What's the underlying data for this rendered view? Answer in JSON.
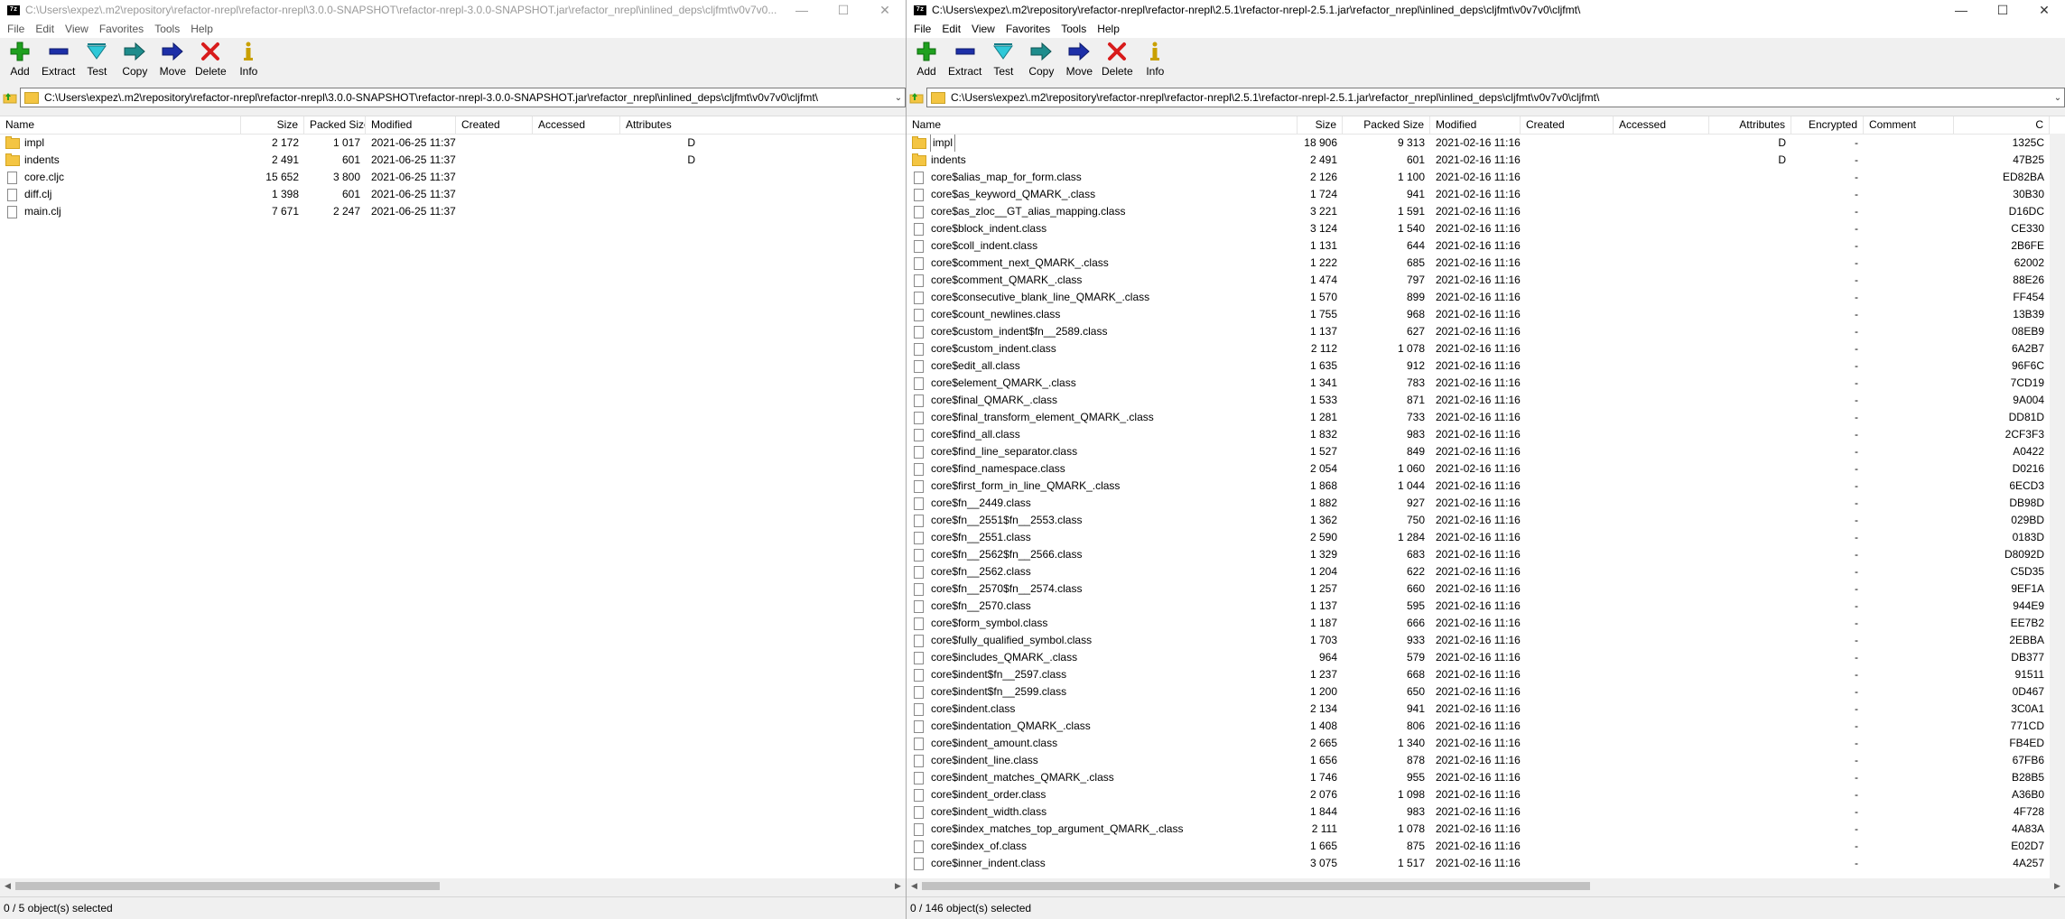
{
  "left": {
    "title": "C:\\Users\\expez\\.m2\\repository\\refactor-nrepl\\refactor-nrepl\\3.0.0-SNAPSHOT\\refactor-nrepl-3.0.0-SNAPSHOT.jar\\refactor_nrepl\\inlined_deps\\cljfmt\\v0v7v0...",
    "menu": [
      "File",
      "Edit",
      "View",
      "Favorites",
      "Tools",
      "Help"
    ],
    "toolbar": [
      "Add",
      "Extract",
      "Test",
      "Copy",
      "Move",
      "Delete",
      "Info"
    ],
    "address": "C:\\Users\\expez\\.m2\\repository\\refactor-nrepl\\refactor-nrepl\\3.0.0-SNAPSHOT\\refactor-nrepl-3.0.0-SNAPSHOT.jar\\refactor_nrepl\\inlined_deps\\cljfmt\\v0v7v0\\cljfmt\\",
    "columns": [
      "Name",
      "Size",
      "Packed Size",
      "Modified",
      "Created",
      "Accessed",
      "Attributes"
    ],
    "rows": [
      {
        "type": "folder",
        "name": "impl",
        "size": "2 172",
        "packed": "1 017",
        "modified": "2021-06-25 11:37",
        "attr": "D"
      },
      {
        "type": "folder",
        "name": "indents",
        "size": "2 491",
        "packed": "601",
        "modified": "2021-06-25 11:37",
        "attr": "D"
      },
      {
        "type": "file",
        "name": "core.cljc",
        "size": "15 652",
        "packed": "3 800",
        "modified": "2021-06-25 11:37",
        "attr": ""
      },
      {
        "type": "file",
        "name": "diff.clj",
        "size": "1 398",
        "packed": "601",
        "modified": "2021-06-25 11:37",
        "attr": ""
      },
      {
        "type": "file",
        "name": "main.clj",
        "size": "7 671",
        "packed": "2 247",
        "modified": "2021-06-25 11:37",
        "attr": ""
      }
    ],
    "status": "0 / 5 object(s) selected"
  },
  "right": {
    "title": "C:\\Users\\expez\\.m2\\repository\\refactor-nrepl\\refactor-nrepl\\2.5.1\\refactor-nrepl-2.5.1.jar\\refactor_nrepl\\inlined_deps\\cljfmt\\v0v7v0\\cljfmt\\",
    "menu": [
      "File",
      "Edit",
      "View",
      "Favorites",
      "Tools",
      "Help"
    ],
    "toolbar": [
      "Add",
      "Extract",
      "Test",
      "Copy",
      "Move",
      "Delete",
      "Info"
    ],
    "address": "C:\\Users\\expez\\.m2\\repository\\refactor-nrepl\\refactor-nrepl\\2.5.1\\refactor-nrepl-2.5.1.jar\\refactor_nrepl\\inlined_deps\\cljfmt\\v0v7v0\\cljfmt\\",
    "columns": [
      "Name",
      "Size",
      "Packed Size",
      "Modified",
      "Created",
      "Accessed",
      "Attributes",
      "Encrypted",
      "Comment",
      "C"
    ],
    "rows": [
      {
        "type": "folder",
        "name": "impl",
        "size": "18 906",
        "packed": "9 313",
        "modified": "2021-02-16 11:16",
        "attr": "D",
        "enc": "-",
        "crc": "1325C"
      },
      {
        "type": "folder",
        "name": "indents",
        "size": "2 491",
        "packed": "601",
        "modified": "2021-02-16 11:16",
        "attr": "D",
        "enc": "-",
        "crc": "47B25"
      },
      {
        "type": "file",
        "name": "core$alias_map_for_form.class",
        "size": "2 126",
        "packed": "1 100",
        "modified": "2021-02-16 11:16",
        "attr": "",
        "enc": "-",
        "crc": "ED82BA"
      },
      {
        "type": "file",
        "name": "core$as_keyword_QMARK_.class",
        "size": "1 724",
        "packed": "941",
        "modified": "2021-02-16 11:16",
        "attr": "",
        "enc": "-",
        "crc": "30B30"
      },
      {
        "type": "file",
        "name": "core$as_zloc__GT_alias_mapping.class",
        "size": "3 221",
        "packed": "1 591",
        "modified": "2021-02-16 11:16",
        "attr": "",
        "enc": "-",
        "crc": "D16DC"
      },
      {
        "type": "file",
        "name": "core$block_indent.class",
        "size": "3 124",
        "packed": "1 540",
        "modified": "2021-02-16 11:16",
        "attr": "",
        "enc": "-",
        "crc": "CE330"
      },
      {
        "type": "file",
        "name": "core$coll_indent.class",
        "size": "1 131",
        "packed": "644",
        "modified": "2021-02-16 11:16",
        "attr": "",
        "enc": "-",
        "crc": "2B6FE"
      },
      {
        "type": "file",
        "name": "core$comment_next_QMARK_.class",
        "size": "1 222",
        "packed": "685",
        "modified": "2021-02-16 11:16",
        "attr": "",
        "enc": "-",
        "crc": "62002"
      },
      {
        "type": "file",
        "name": "core$comment_QMARK_.class",
        "size": "1 474",
        "packed": "797",
        "modified": "2021-02-16 11:16",
        "attr": "",
        "enc": "-",
        "crc": "88E26"
      },
      {
        "type": "file",
        "name": "core$consecutive_blank_line_QMARK_.class",
        "size": "1 570",
        "packed": "899",
        "modified": "2021-02-16 11:16",
        "attr": "",
        "enc": "-",
        "crc": "FF454"
      },
      {
        "type": "file",
        "name": "core$count_newlines.class",
        "size": "1 755",
        "packed": "968",
        "modified": "2021-02-16 11:16",
        "attr": "",
        "enc": "-",
        "crc": "13B39"
      },
      {
        "type": "file",
        "name": "core$custom_indent$fn__2589.class",
        "size": "1 137",
        "packed": "627",
        "modified": "2021-02-16 11:16",
        "attr": "",
        "enc": "-",
        "crc": "08EB9"
      },
      {
        "type": "file",
        "name": "core$custom_indent.class",
        "size": "2 112",
        "packed": "1 078",
        "modified": "2021-02-16 11:16",
        "attr": "",
        "enc": "-",
        "crc": "6A2B7"
      },
      {
        "type": "file",
        "name": "core$edit_all.class",
        "size": "1 635",
        "packed": "912",
        "modified": "2021-02-16 11:16",
        "attr": "",
        "enc": "-",
        "crc": "96F6C"
      },
      {
        "type": "file",
        "name": "core$element_QMARK_.class",
        "size": "1 341",
        "packed": "783",
        "modified": "2021-02-16 11:16",
        "attr": "",
        "enc": "-",
        "crc": "7CD19"
      },
      {
        "type": "file",
        "name": "core$final_QMARK_.class",
        "size": "1 533",
        "packed": "871",
        "modified": "2021-02-16 11:16",
        "attr": "",
        "enc": "-",
        "crc": "9A004"
      },
      {
        "type": "file",
        "name": "core$final_transform_element_QMARK_.class",
        "size": "1 281",
        "packed": "733",
        "modified": "2021-02-16 11:16",
        "attr": "",
        "enc": "-",
        "crc": "DD81D"
      },
      {
        "type": "file",
        "name": "core$find_all.class",
        "size": "1 832",
        "packed": "983",
        "modified": "2021-02-16 11:16",
        "attr": "",
        "enc": "-",
        "crc": "2CF3F3"
      },
      {
        "type": "file",
        "name": "core$find_line_separator.class",
        "size": "1 527",
        "packed": "849",
        "modified": "2021-02-16 11:16",
        "attr": "",
        "enc": "-",
        "crc": "A0422"
      },
      {
        "type": "file",
        "name": "core$find_namespace.class",
        "size": "2 054",
        "packed": "1 060",
        "modified": "2021-02-16 11:16",
        "attr": "",
        "enc": "-",
        "crc": "D0216"
      },
      {
        "type": "file",
        "name": "core$first_form_in_line_QMARK_.class",
        "size": "1 868",
        "packed": "1 044",
        "modified": "2021-02-16 11:16",
        "attr": "",
        "enc": "-",
        "crc": "6ECD3"
      },
      {
        "type": "file",
        "name": "core$fn__2449.class",
        "size": "1 882",
        "packed": "927",
        "modified": "2021-02-16 11:16",
        "attr": "",
        "enc": "-",
        "crc": "DB98D"
      },
      {
        "type": "file",
        "name": "core$fn__2551$fn__2553.class",
        "size": "1 362",
        "packed": "750",
        "modified": "2021-02-16 11:16",
        "attr": "",
        "enc": "-",
        "crc": "029BD"
      },
      {
        "type": "file",
        "name": "core$fn__2551.class",
        "size": "2 590",
        "packed": "1 284",
        "modified": "2021-02-16 11:16",
        "attr": "",
        "enc": "-",
        "crc": "0183D"
      },
      {
        "type": "file",
        "name": "core$fn__2562$fn__2566.class",
        "size": "1 329",
        "packed": "683",
        "modified": "2021-02-16 11:16",
        "attr": "",
        "enc": "-",
        "crc": "D8092D"
      },
      {
        "type": "file",
        "name": "core$fn__2562.class",
        "size": "1 204",
        "packed": "622",
        "modified": "2021-02-16 11:16",
        "attr": "",
        "enc": "-",
        "crc": "C5D35"
      },
      {
        "type": "file",
        "name": "core$fn__2570$fn__2574.class",
        "size": "1 257",
        "packed": "660",
        "modified": "2021-02-16 11:16",
        "attr": "",
        "enc": "-",
        "crc": "9EF1A"
      },
      {
        "type": "file",
        "name": "core$fn__2570.class",
        "size": "1 137",
        "packed": "595",
        "modified": "2021-02-16 11:16",
        "attr": "",
        "enc": "-",
        "crc": "944E9"
      },
      {
        "type": "file",
        "name": "core$form_symbol.class",
        "size": "1 187",
        "packed": "666",
        "modified": "2021-02-16 11:16",
        "attr": "",
        "enc": "-",
        "crc": "EE7B2"
      },
      {
        "type": "file",
        "name": "core$fully_qualified_symbol.class",
        "size": "1 703",
        "packed": "933",
        "modified": "2021-02-16 11:16",
        "attr": "",
        "enc": "-",
        "crc": "2EBBA"
      },
      {
        "type": "file",
        "name": "core$includes_QMARK_.class",
        "size": "964",
        "packed": "579",
        "modified": "2021-02-16 11:16",
        "attr": "",
        "enc": "-",
        "crc": "DB377"
      },
      {
        "type": "file",
        "name": "core$indent$fn__2597.class",
        "size": "1 237",
        "packed": "668",
        "modified": "2021-02-16 11:16",
        "attr": "",
        "enc": "-",
        "crc": "91511"
      },
      {
        "type": "file",
        "name": "core$indent$fn__2599.class",
        "size": "1 200",
        "packed": "650",
        "modified": "2021-02-16 11:16",
        "attr": "",
        "enc": "-",
        "crc": "0D467"
      },
      {
        "type": "file",
        "name": "core$indent.class",
        "size": "2 134",
        "packed": "941",
        "modified": "2021-02-16 11:16",
        "attr": "",
        "enc": "-",
        "crc": "3C0A1"
      },
      {
        "type": "file",
        "name": "core$indentation_QMARK_.class",
        "size": "1 408",
        "packed": "806",
        "modified": "2021-02-16 11:16",
        "attr": "",
        "enc": "-",
        "crc": "771CD"
      },
      {
        "type": "file",
        "name": "core$indent_amount.class",
        "size": "2 665",
        "packed": "1 340",
        "modified": "2021-02-16 11:16",
        "attr": "",
        "enc": "-",
        "crc": "FB4ED"
      },
      {
        "type": "file",
        "name": "core$indent_line.class",
        "size": "1 656",
        "packed": "878",
        "modified": "2021-02-16 11:16",
        "attr": "",
        "enc": "-",
        "crc": "67FB6"
      },
      {
        "type": "file",
        "name": "core$indent_matches_QMARK_.class",
        "size": "1 746",
        "packed": "955",
        "modified": "2021-02-16 11:16",
        "attr": "",
        "enc": "-",
        "crc": "B28B5"
      },
      {
        "type": "file",
        "name": "core$indent_order.class",
        "size": "2 076",
        "packed": "1 098",
        "modified": "2021-02-16 11:16",
        "attr": "",
        "enc": "-",
        "crc": "A36B0"
      },
      {
        "type": "file",
        "name": "core$indent_width.class",
        "size": "1 844",
        "packed": "983",
        "modified": "2021-02-16 11:16",
        "attr": "",
        "enc": "-",
        "crc": "4F728"
      },
      {
        "type": "file",
        "name": "core$index_matches_top_argument_QMARK_.class",
        "size": "2 111",
        "packed": "1 078",
        "modified": "2021-02-16 11:16",
        "attr": "",
        "enc": "-",
        "crc": "4A83A"
      },
      {
        "type": "file",
        "name": "core$index_of.class",
        "size": "1 665",
        "packed": "875",
        "modified": "2021-02-16 11:16",
        "attr": "",
        "enc": "-",
        "crc": "E02D7"
      },
      {
        "type": "file",
        "name": "core$inner_indent.class",
        "size": "3 075",
        "packed": "1 517",
        "modified": "2021-02-16 11:16",
        "attr": "",
        "enc": "-",
        "crc": "4A257"
      }
    ],
    "status": "0 / 146 object(s) selected"
  }
}
